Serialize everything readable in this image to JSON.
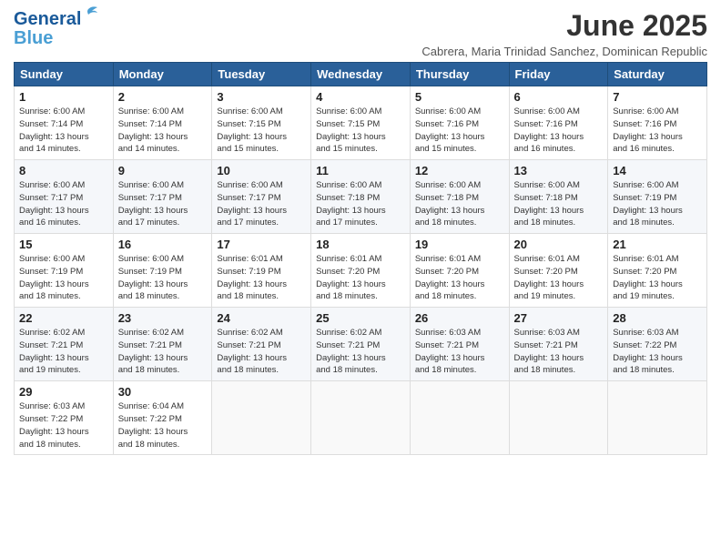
{
  "header": {
    "logo_line1": "General",
    "logo_line2": "Blue",
    "month_title": "June 2025",
    "subtitle": "Cabrera, Maria Trinidad Sanchez, Dominican Republic"
  },
  "days_of_week": [
    "Sunday",
    "Monday",
    "Tuesday",
    "Wednesday",
    "Thursday",
    "Friday",
    "Saturday"
  ],
  "weeks": [
    [
      {
        "day": "1",
        "info": "Sunrise: 6:00 AM\nSunset: 7:14 PM\nDaylight: 13 hours\nand 14 minutes."
      },
      {
        "day": "2",
        "info": "Sunrise: 6:00 AM\nSunset: 7:14 PM\nDaylight: 13 hours\nand 14 minutes."
      },
      {
        "day": "3",
        "info": "Sunrise: 6:00 AM\nSunset: 7:15 PM\nDaylight: 13 hours\nand 15 minutes."
      },
      {
        "day": "4",
        "info": "Sunrise: 6:00 AM\nSunset: 7:15 PM\nDaylight: 13 hours\nand 15 minutes."
      },
      {
        "day": "5",
        "info": "Sunrise: 6:00 AM\nSunset: 7:16 PM\nDaylight: 13 hours\nand 15 minutes."
      },
      {
        "day": "6",
        "info": "Sunrise: 6:00 AM\nSunset: 7:16 PM\nDaylight: 13 hours\nand 16 minutes."
      },
      {
        "day": "7",
        "info": "Sunrise: 6:00 AM\nSunset: 7:16 PM\nDaylight: 13 hours\nand 16 minutes."
      }
    ],
    [
      {
        "day": "8",
        "info": "Sunrise: 6:00 AM\nSunset: 7:17 PM\nDaylight: 13 hours\nand 16 minutes."
      },
      {
        "day": "9",
        "info": "Sunrise: 6:00 AM\nSunset: 7:17 PM\nDaylight: 13 hours\nand 17 minutes."
      },
      {
        "day": "10",
        "info": "Sunrise: 6:00 AM\nSunset: 7:17 PM\nDaylight: 13 hours\nand 17 minutes."
      },
      {
        "day": "11",
        "info": "Sunrise: 6:00 AM\nSunset: 7:18 PM\nDaylight: 13 hours\nand 17 minutes."
      },
      {
        "day": "12",
        "info": "Sunrise: 6:00 AM\nSunset: 7:18 PM\nDaylight: 13 hours\nand 18 minutes."
      },
      {
        "day": "13",
        "info": "Sunrise: 6:00 AM\nSunset: 7:18 PM\nDaylight: 13 hours\nand 18 minutes."
      },
      {
        "day": "14",
        "info": "Sunrise: 6:00 AM\nSunset: 7:19 PM\nDaylight: 13 hours\nand 18 minutes."
      }
    ],
    [
      {
        "day": "15",
        "info": "Sunrise: 6:00 AM\nSunset: 7:19 PM\nDaylight: 13 hours\nand 18 minutes."
      },
      {
        "day": "16",
        "info": "Sunrise: 6:00 AM\nSunset: 7:19 PM\nDaylight: 13 hours\nand 18 minutes."
      },
      {
        "day": "17",
        "info": "Sunrise: 6:01 AM\nSunset: 7:19 PM\nDaylight: 13 hours\nand 18 minutes."
      },
      {
        "day": "18",
        "info": "Sunrise: 6:01 AM\nSunset: 7:20 PM\nDaylight: 13 hours\nand 18 minutes."
      },
      {
        "day": "19",
        "info": "Sunrise: 6:01 AM\nSunset: 7:20 PM\nDaylight: 13 hours\nand 18 minutes."
      },
      {
        "day": "20",
        "info": "Sunrise: 6:01 AM\nSunset: 7:20 PM\nDaylight: 13 hours\nand 19 minutes."
      },
      {
        "day": "21",
        "info": "Sunrise: 6:01 AM\nSunset: 7:20 PM\nDaylight: 13 hours\nand 19 minutes."
      }
    ],
    [
      {
        "day": "22",
        "info": "Sunrise: 6:02 AM\nSunset: 7:21 PM\nDaylight: 13 hours\nand 19 minutes."
      },
      {
        "day": "23",
        "info": "Sunrise: 6:02 AM\nSunset: 7:21 PM\nDaylight: 13 hours\nand 18 minutes."
      },
      {
        "day": "24",
        "info": "Sunrise: 6:02 AM\nSunset: 7:21 PM\nDaylight: 13 hours\nand 18 minutes."
      },
      {
        "day": "25",
        "info": "Sunrise: 6:02 AM\nSunset: 7:21 PM\nDaylight: 13 hours\nand 18 minutes."
      },
      {
        "day": "26",
        "info": "Sunrise: 6:03 AM\nSunset: 7:21 PM\nDaylight: 13 hours\nand 18 minutes."
      },
      {
        "day": "27",
        "info": "Sunrise: 6:03 AM\nSunset: 7:21 PM\nDaylight: 13 hours\nand 18 minutes."
      },
      {
        "day": "28",
        "info": "Sunrise: 6:03 AM\nSunset: 7:22 PM\nDaylight: 13 hours\nand 18 minutes."
      }
    ],
    [
      {
        "day": "29",
        "info": "Sunrise: 6:03 AM\nSunset: 7:22 PM\nDaylight: 13 hours\nand 18 minutes."
      },
      {
        "day": "30",
        "info": "Sunrise: 6:04 AM\nSunset: 7:22 PM\nDaylight: 13 hours\nand 18 minutes."
      },
      {
        "day": "",
        "info": ""
      },
      {
        "day": "",
        "info": ""
      },
      {
        "day": "",
        "info": ""
      },
      {
        "day": "",
        "info": ""
      },
      {
        "day": "",
        "info": ""
      }
    ]
  ]
}
